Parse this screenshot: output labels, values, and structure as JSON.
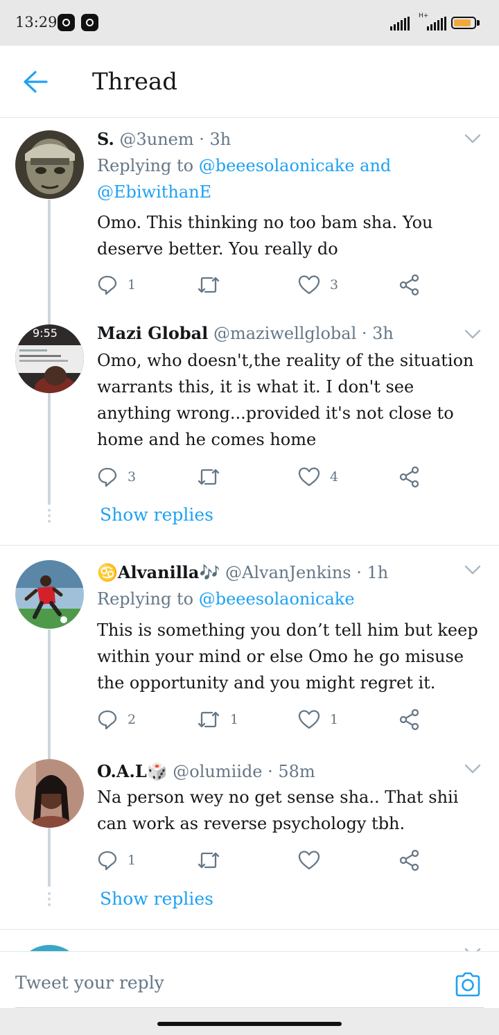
{
  "status_bar": {
    "time": "13:29",
    "network": "H+"
  },
  "header": {
    "title": "Thread"
  },
  "tweets": [
    {
      "name": "S.",
      "handle": "@3unem",
      "time": "3h",
      "replying_label": "Replying to",
      "replying_line1": "@beeesolaonicake and",
      "replying_line2": "@EbiwithanE",
      "text": "Omo. This thinking no too bam sha. You deserve better. You really do",
      "replies": "1",
      "retweets": "",
      "likes": "3"
    },
    {
      "name": "Mazi Global",
      "handle": "@maziwellglobal",
      "time": "3h",
      "text": "Omo, who doesn't,the reality of the situation warrants this, it is what it. I don't see anything wrong...provided it's not close to home and he comes home",
      "replies": "3",
      "retweets": "",
      "likes": "4",
      "show_replies": "Show replies",
      "avatar_screen_time": "9:55"
    },
    {
      "name": "Alvanilla",
      "name_prefix_emoji": "♋",
      "name_suffix_emoji": "🎶",
      "handle": "@AlvanJenkins",
      "time": "1h",
      "replying_label": "Replying to",
      "replying_line1": "@beeesolaonicake",
      "text": "This is something you don’t tell him but keep within your mind or else Omo he go misuse the opportunity and you might regret it.",
      "replies": "2",
      "retweets": "1",
      "likes": "1"
    },
    {
      "name": "O.A.L",
      "name_suffix_emoji": "🎲",
      "handle": "@olumiide",
      "time": "58m",
      "text": "Na person wey no get sense sha.. That shii can work as reverse psychology tbh.",
      "replies": "1",
      "retweets": "",
      "likes": "",
      "show_replies": "Show replies"
    }
  ],
  "composer": {
    "placeholder": "Tweet your reply"
  },
  "colors": {
    "accent": "#1da1f2",
    "secondary_text": "#657786",
    "thread_line": "#ccd6dd",
    "battery": "#f1a93b"
  },
  "icons": [
    "back-arrow-icon",
    "reply-icon",
    "retweet-icon",
    "like-icon",
    "share-icon",
    "chevron-down-icon",
    "camera-icon"
  ]
}
